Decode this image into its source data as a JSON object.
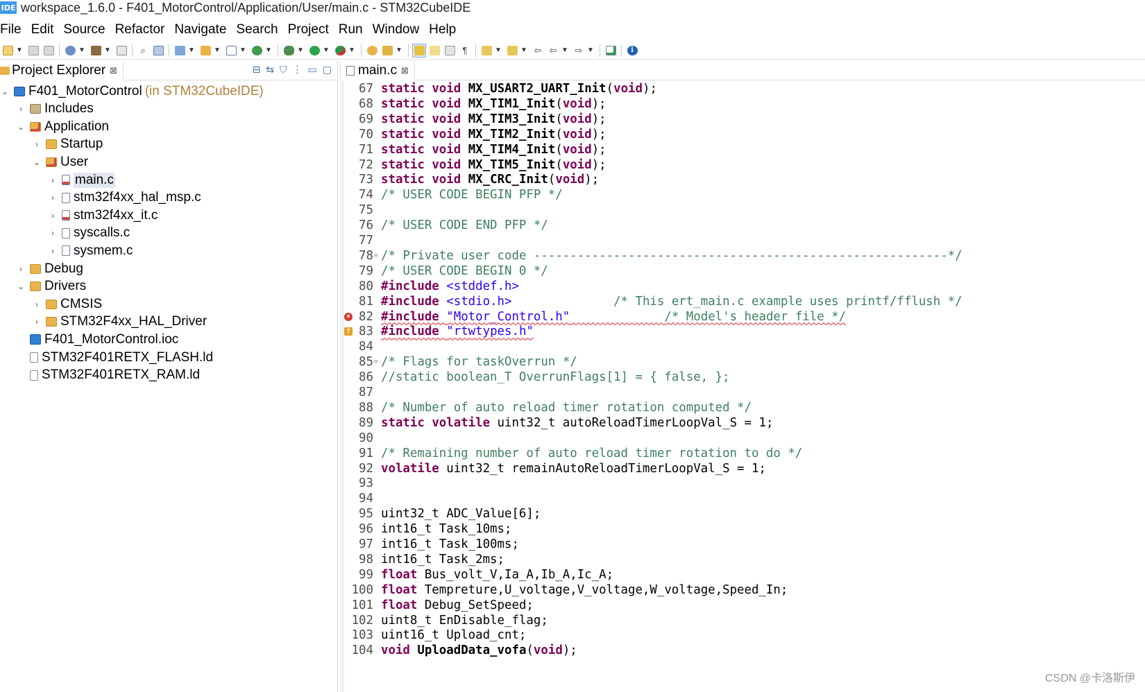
{
  "window": {
    "app_icon_text": "IDE",
    "title": "workspace_1.6.0 - F401_MotorControl/Application/User/main.c - STM32CubeIDE"
  },
  "menu": [
    "File",
    "Edit",
    "Source",
    "Refactor",
    "Navigate",
    "Search",
    "Project",
    "Run",
    "Window",
    "Help"
  ],
  "project_explorer": {
    "title": "Project Explorer",
    "close_glyph": "⊠",
    "tree": [
      {
        "label": "F401_MotorControl",
        "decoration": "(in STM32CubeIDE)",
        "icon": "project-icon",
        "twisty": "expanded"
      },
      {
        "label": "Includes",
        "icon": "includes-icon",
        "twisty": "collapsed"
      },
      {
        "label": "Application",
        "icon": "source-folder-icon",
        "twisty": "expanded"
      },
      {
        "label": "Startup",
        "icon": "folder-icon",
        "twisty": "collapsed"
      },
      {
        "label": "User",
        "icon": "source-folder-icon",
        "twisty": "expanded"
      },
      {
        "label": "main.c",
        "icon": "c-file-error-icon",
        "twisty": "collapsed",
        "selected": true
      },
      {
        "label": "stm32f4xx_hal_msp.c",
        "icon": "c-file-icon",
        "twisty": "collapsed"
      },
      {
        "label": "stm32f4xx_it.c",
        "icon": "c-file-error-icon",
        "twisty": "collapsed"
      },
      {
        "label": "syscalls.c",
        "icon": "c-file-icon",
        "twisty": "collapsed"
      },
      {
        "label": "sysmem.c",
        "icon": "c-file-icon",
        "twisty": "collapsed"
      },
      {
        "label": "Debug",
        "icon": "folder-icon",
        "twisty": "collapsed"
      },
      {
        "label": "Drivers",
        "icon": "folder-icon",
        "twisty": "expanded"
      },
      {
        "label": "CMSIS",
        "icon": "folder-icon",
        "twisty": "collapsed"
      },
      {
        "label": "STM32F4xx_HAL_Driver",
        "icon": "folder-icon",
        "twisty": "collapsed"
      },
      {
        "label": "F401_MotorControl.ioc",
        "icon": "ioc-file-icon",
        "twisty": "none"
      },
      {
        "label": "STM32F401RETX_FLASH.ld",
        "icon": "linker-file-icon",
        "twisty": "none"
      },
      {
        "label": "STM32F401RETX_RAM.ld",
        "icon": "linker-file-icon",
        "twisty": "none"
      }
    ]
  },
  "editor": {
    "tab_label": "main.c",
    "close_glyph": "⊠",
    "lines": [
      {
        "n": "67",
        "code": "static void MX_USART2_UART_Init(void);"
      },
      {
        "n": "68",
        "code": "static void MX_TIM1_Init(void);"
      },
      {
        "n": "69",
        "code": "static void MX_TIM3_Init(void);"
      },
      {
        "n": "70",
        "code": "static void MX_TIM2_Init(void);"
      },
      {
        "n": "71",
        "code": "static void MX_TIM4_Init(void);"
      },
      {
        "n": "72",
        "code": "static void MX_TIM5_Init(void);"
      },
      {
        "n": "73",
        "code": "static void MX_CRC_Init(void);"
      },
      {
        "n": "74",
        "code": "/* USER CODE BEGIN PFP */"
      },
      {
        "n": "75",
        "code": ""
      },
      {
        "n": "76",
        "code": "/* USER CODE END PFP */"
      },
      {
        "n": "77",
        "code": ""
      },
      {
        "n": "78",
        "code": "/* Private user code ---------------------------------------------------------*/",
        "fold": true
      },
      {
        "n": "79",
        "code": "/* USER CODE BEGIN 0 */"
      },
      {
        "n": "80",
        "code": "#include <stddef.h>"
      },
      {
        "n": "81",
        "code": "#include <stdio.h>              /* This ert_main.c example uses printf/fflush */"
      },
      {
        "n": "82",
        "code": "#include \"Motor_Control.h\"             /* Model's header file */",
        "marker": "error"
      },
      {
        "n": "83",
        "code": "#include \"rtwtypes.h\"",
        "marker": "warning"
      },
      {
        "n": "84",
        "code": ""
      },
      {
        "n": "85",
        "code": "/* Flags for taskOverrun */",
        "fold": true
      },
      {
        "n": "86",
        "code": "//static boolean_T OverrunFlags[1] = { false, };"
      },
      {
        "n": "87",
        "code": ""
      },
      {
        "n": "88",
        "code": "/* Number of auto reload timer rotation computed */"
      },
      {
        "n": "89",
        "code": "static volatile uint32_t autoReloadTimerLoopVal_S = 1;"
      },
      {
        "n": "90",
        "code": ""
      },
      {
        "n": "91",
        "code": "/* Remaining number of auto reload timer rotation to do */"
      },
      {
        "n": "92",
        "code": "volatile uint32_t remainAutoReloadTimerLoopVal_S = 1;"
      },
      {
        "n": "93",
        "code": ""
      },
      {
        "n": "94",
        "code": ""
      },
      {
        "n": "95",
        "code": "uint32_t ADC_Value[6];"
      },
      {
        "n": "96",
        "code": "int16_t Task_10ms;"
      },
      {
        "n": "97",
        "code": "int16_t Task_100ms;"
      },
      {
        "n": "98",
        "code": "int16_t Task_2ms;"
      },
      {
        "n": "99",
        "code": "float Bus_volt_V,Ia_A,Ib_A,Ic_A;"
      },
      {
        "n": "100",
        "code": "float Tempreture,U_voltage,V_voltage,W_voltage,Speed_In;"
      },
      {
        "n": "101",
        "code": "float Debug_SetSpeed;"
      },
      {
        "n": "102",
        "code": "uint8_t EnDisable_flag;"
      },
      {
        "n": "103",
        "code": "uint16_t Upload_cnt;"
      },
      {
        "n": "104",
        "code": "void UploadData_vofa(void);"
      }
    ]
  },
  "watermark": "CSDN @卡洛斯伊"
}
